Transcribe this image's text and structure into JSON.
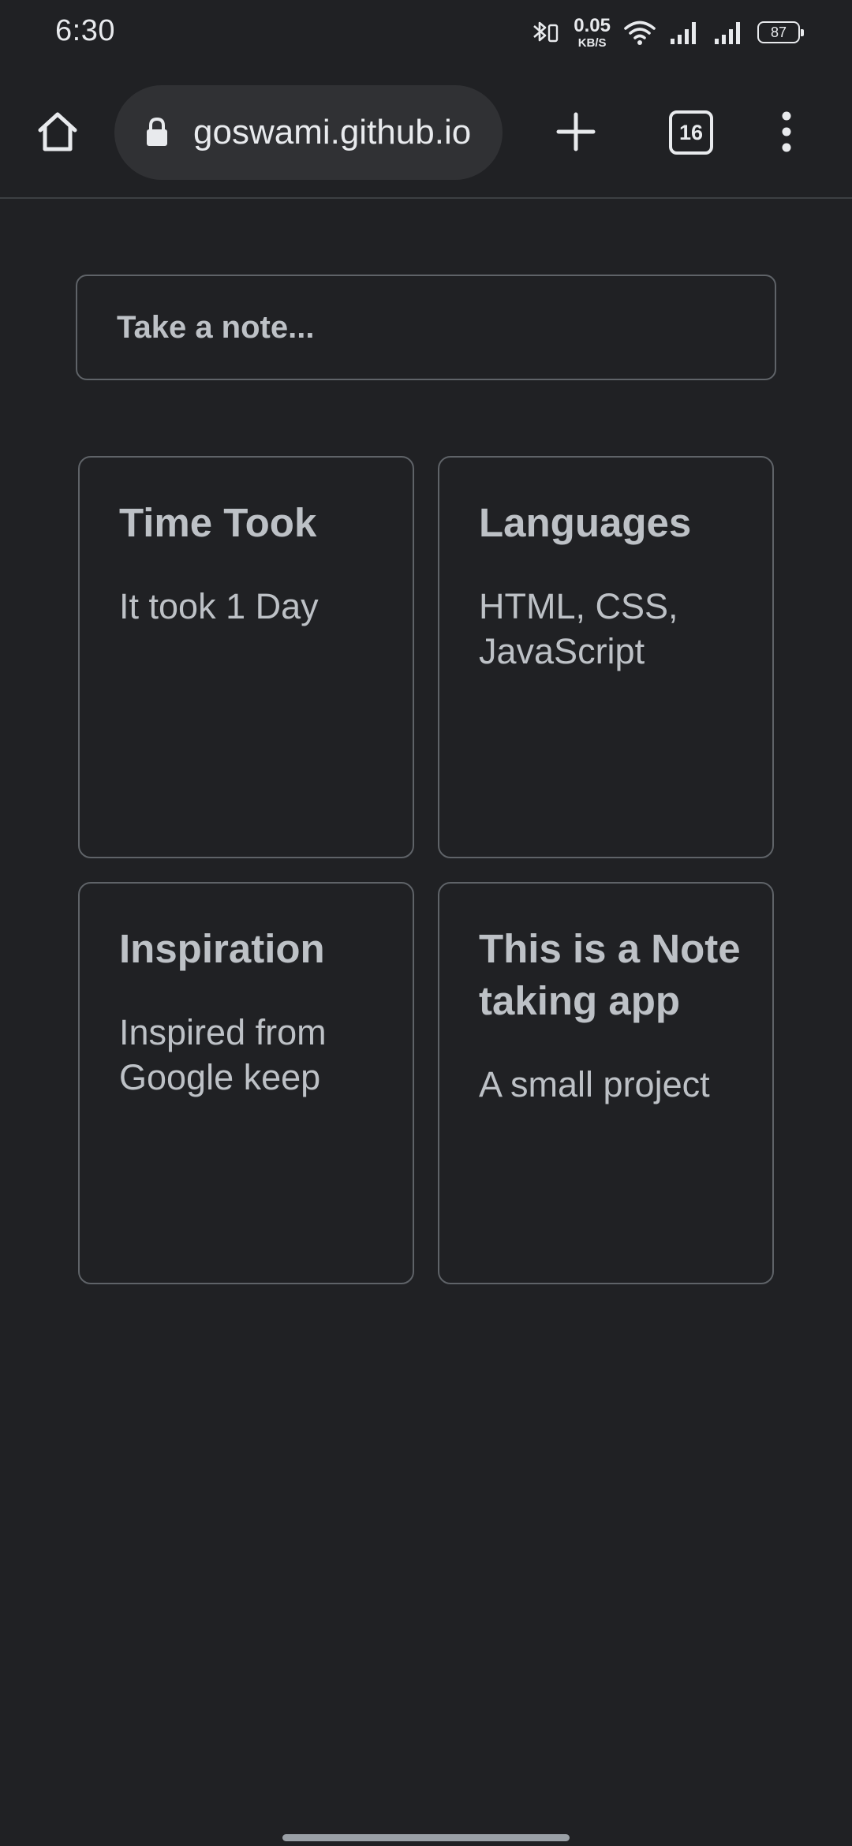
{
  "status_bar": {
    "time": "6:30",
    "net_speed_value": "0.05",
    "net_speed_unit": "KB/S",
    "battery": "87",
    "icons": [
      "bluetooth-icon",
      "wifi-icon",
      "signal-icon",
      "signal-icon",
      "battery-icon"
    ]
  },
  "browser": {
    "url": "goswami.github.io",
    "tab_count": "16",
    "icons": [
      "home-icon",
      "lock-icon",
      "plus-icon",
      "tabs-icon",
      "more-vert-icon"
    ]
  },
  "page": {
    "note_input_placeholder": "Take a note...",
    "notes": [
      {
        "title": "Time Took",
        "body": "It took 1 Day"
      },
      {
        "title": "Languages",
        "body": "HTML, CSS, JavaScript"
      },
      {
        "title": "Inspiration",
        "body": "Inspired from Google keep"
      },
      {
        "title": "This is a Note taking app",
        "body": "A small project"
      }
    ]
  },
  "colors": {
    "background": "#202124",
    "text": "#bdc1c6",
    "border": "#5f6368",
    "omnibox": "#303134"
  }
}
